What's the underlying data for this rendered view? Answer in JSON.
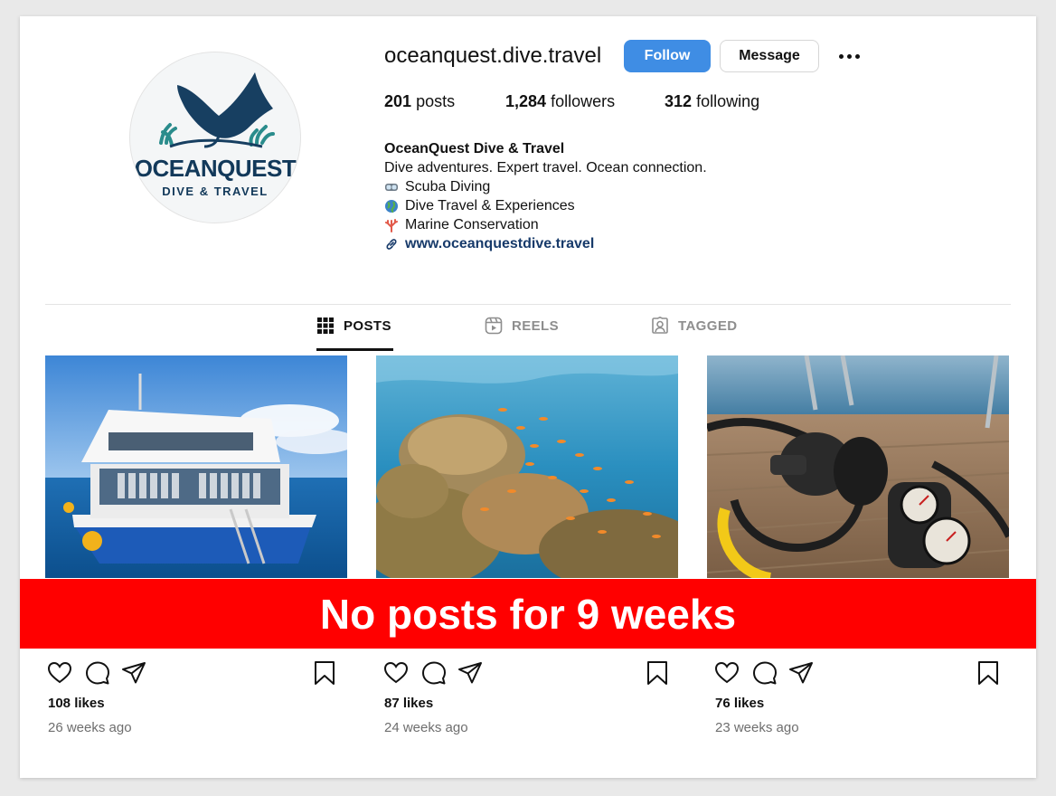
{
  "profile": {
    "username": "oceanquest.dive.travel",
    "follow_label": "Follow",
    "message_label": "Message",
    "logo_name": "OCEANQUEST",
    "logo_sub": "DIVE & TRAVEL",
    "stats": {
      "posts_count": "201",
      "posts_label": "posts",
      "followers_count": "1,284",
      "followers_label": "followers",
      "following_count": "312",
      "following_label": "following"
    },
    "bio": {
      "name": "OceanQuest Dive & Travel",
      "tagline": "Dive adventures. Expert travel. Ocean connection.",
      "line1": "Scuba Diving",
      "line2": "Dive Travel & Experiences",
      "line3": "Marine Conservation",
      "link": "www.oceanquestdive.travel"
    }
  },
  "tabs": [
    {
      "label": "POSTS",
      "icon": "grid-icon",
      "active": true
    },
    {
      "label": "REELS",
      "icon": "reels-icon",
      "active": false
    },
    {
      "label": "TAGGED",
      "icon": "tagged-icon",
      "active": false
    }
  ],
  "banner": {
    "text": "No posts for 9 weeks",
    "color": "#ff0000"
  },
  "posts": [
    {
      "image": "dive-boat-photo",
      "likes": "108 likes",
      "ago": "26 weeks ago"
    },
    {
      "image": "coral-reef-photo",
      "likes": "87 likes",
      "ago": "24 weeks ago"
    },
    {
      "image": "scuba-regulator-photo",
      "likes": "76 likes",
      "ago": "23 weeks ago"
    }
  ],
  "colors": {
    "follow_button": "#3f8de4",
    "link": "#173a6a",
    "logo": "#12395a"
  }
}
